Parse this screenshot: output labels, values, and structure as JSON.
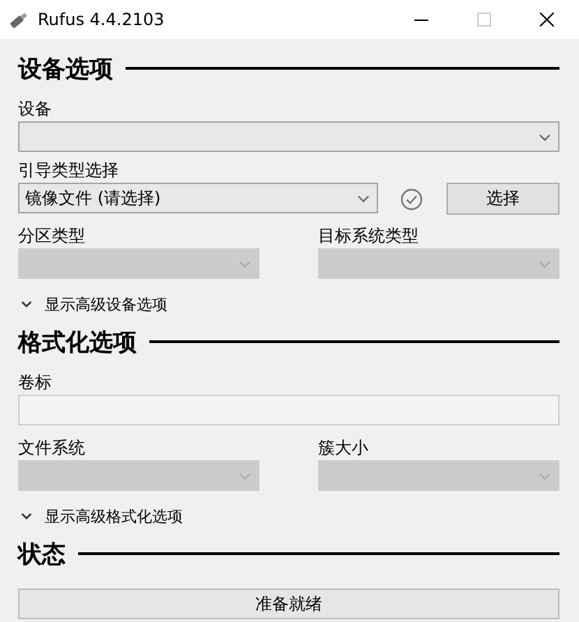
{
  "window": {
    "title": "Rufus 4.4.2103"
  },
  "device_section": {
    "heading": "设备选项",
    "device": {
      "label": "设备",
      "disabled": false
    },
    "boot": {
      "label": "引导类型选择",
      "value": "镜像文件 (请选择)",
      "disabled": false,
      "button": "选择"
    },
    "pairs": [
      {
        "label": "分区类型",
        "disabled": true
      },
      {
        "label": "目标系统类型",
        "disabled": true
      }
    ],
    "advanced": {
      "label": "显示高级设备选项",
      "expanded": false
    }
  },
  "format_section": {
    "heading": "格式化选项",
    "volume": {
      "label": "卷标"
    },
    "pairs": [
      {
        "label": "文件系统",
        "disabled": true
      },
      {
        "label": "簇大小",
        "disabled": true
      }
    ],
    "advanced": {
      "label": "显示高级格式化选项",
      "expanded": false
    }
  },
  "status_section": {
    "heading": "状态",
    "progress": {
      "text": "准备就绪"
    }
  }
}
